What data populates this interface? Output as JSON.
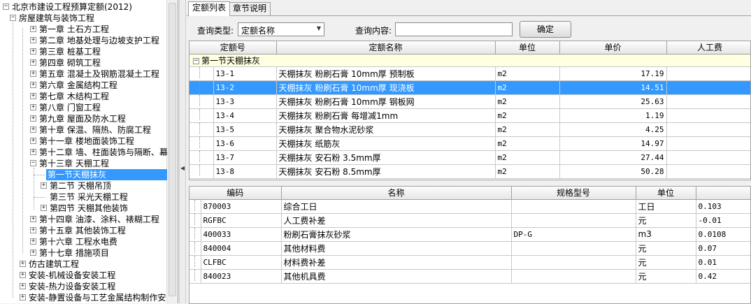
{
  "tree": {
    "root": "北京市建设工程预算定额(2012)",
    "group1": "房屋建筑与装饰工程",
    "chapters": [
      "第一章 土石方工程",
      "第二章 地基处理与边坡支护工程",
      "第三章 桩基工程",
      "第四章 砌筑工程",
      "第五章 混凝土及钢筋混凝土工程",
      "第六章 金属结构工程",
      "第七章 木结构工程",
      "第八章 门窗工程",
      "第九章 屋面及防水工程",
      "第十章 保温、隔热、防腐工程",
      "第十一章 楼地面装饰工程",
      "第十二章 墙、柱面装饰与隔断、幕",
      "第十三章 天棚工程"
    ],
    "sections": [
      "第一节天棚抹灰",
      "第二节 天棚吊顶",
      "第三节 采光天棚工程",
      "第四节 天棚其他装饰"
    ],
    "chapters_after": [
      "第十四章 油漆、涂料、裱糊工程",
      "第十五章 其他装饰工程",
      "第十六章 工程水电费",
      "第十七章 措施项目"
    ],
    "others": [
      "仿古建筑工程",
      "安装-机械设备安装工程",
      "安装-热力设备安装工程",
      "安装-静置设备与工艺金属结构制作安"
    ]
  },
  "tabs": [
    "定额列表",
    "章节说明"
  ],
  "query": {
    "type_label": "查询类型:",
    "type_value": "定额名称",
    "content_label": "查询内容:",
    "content_value": "",
    "ok_label": "确定"
  },
  "quota_table": {
    "headers": [
      "定额号",
      "定额名称",
      "单位",
      "单价",
      "人工费"
    ],
    "group": "第一节天棚抹灰",
    "rows": [
      {
        "code": "13-1",
        "name": "天棚抹灰 粉刷石膏 10mm厚 预制板",
        "unit": "m2",
        "price": "17.19"
      },
      {
        "code": "13-2",
        "name": "天棚抹灰 粉刷石膏 10mm厚 现浇板",
        "unit": "m2",
        "price": "14.51"
      },
      {
        "code": "13-3",
        "name": "天棚抹灰 粉刷石膏 10mm厚 钢板网",
        "unit": "m2",
        "price": "25.63"
      },
      {
        "code": "13-4",
        "name": "天棚抹灰 粉刷石膏 每增减1mm",
        "unit": "m2",
        "price": "1.19"
      },
      {
        "code": "13-5",
        "name": "天棚抹灰 聚合物水泥砂浆",
        "unit": "m2",
        "price": "4.25"
      },
      {
        "code": "13-6",
        "name": "天棚抹灰 纸筋灰",
        "unit": "m2",
        "price": "14.97"
      },
      {
        "code": "13-7",
        "name": "天棚抹灰 安石粉 3.5mm厚",
        "unit": "m2",
        "price": "27.44"
      },
      {
        "code": "13-8",
        "name": "天棚抹灰 安石粉 8.5mm厚",
        "unit": "m2",
        "price": "50.28"
      }
    ]
  },
  "material_table": {
    "headers": [
      "编码",
      "名称",
      "规格型号",
      "单位",
      ""
    ],
    "rows": [
      {
        "code": "870003",
        "name": "综合工日",
        "spec": "",
        "unit": "工日",
        "qty": "0.103"
      },
      {
        "code": "RGFBC",
        "name": "人工费补差",
        "spec": "",
        "unit": "元",
        "qty": "-0.01"
      },
      {
        "code": "400033",
        "name": "粉刷石膏抹灰砂浆",
        "spec": "DP-G",
        "unit": "m3",
        "qty": "0.0108"
      },
      {
        "code": "840004",
        "name": "其他材料费",
        "spec": "",
        "unit": "元",
        "qty": "0.07"
      },
      {
        "code": "CLFBC",
        "name": "材料费补差",
        "spec": "",
        "unit": "元",
        "qty": "0.01"
      },
      {
        "code": "840023",
        "name": "其他机具费",
        "spec": "",
        "unit": "元",
        "qty": "0.42"
      }
    ]
  }
}
